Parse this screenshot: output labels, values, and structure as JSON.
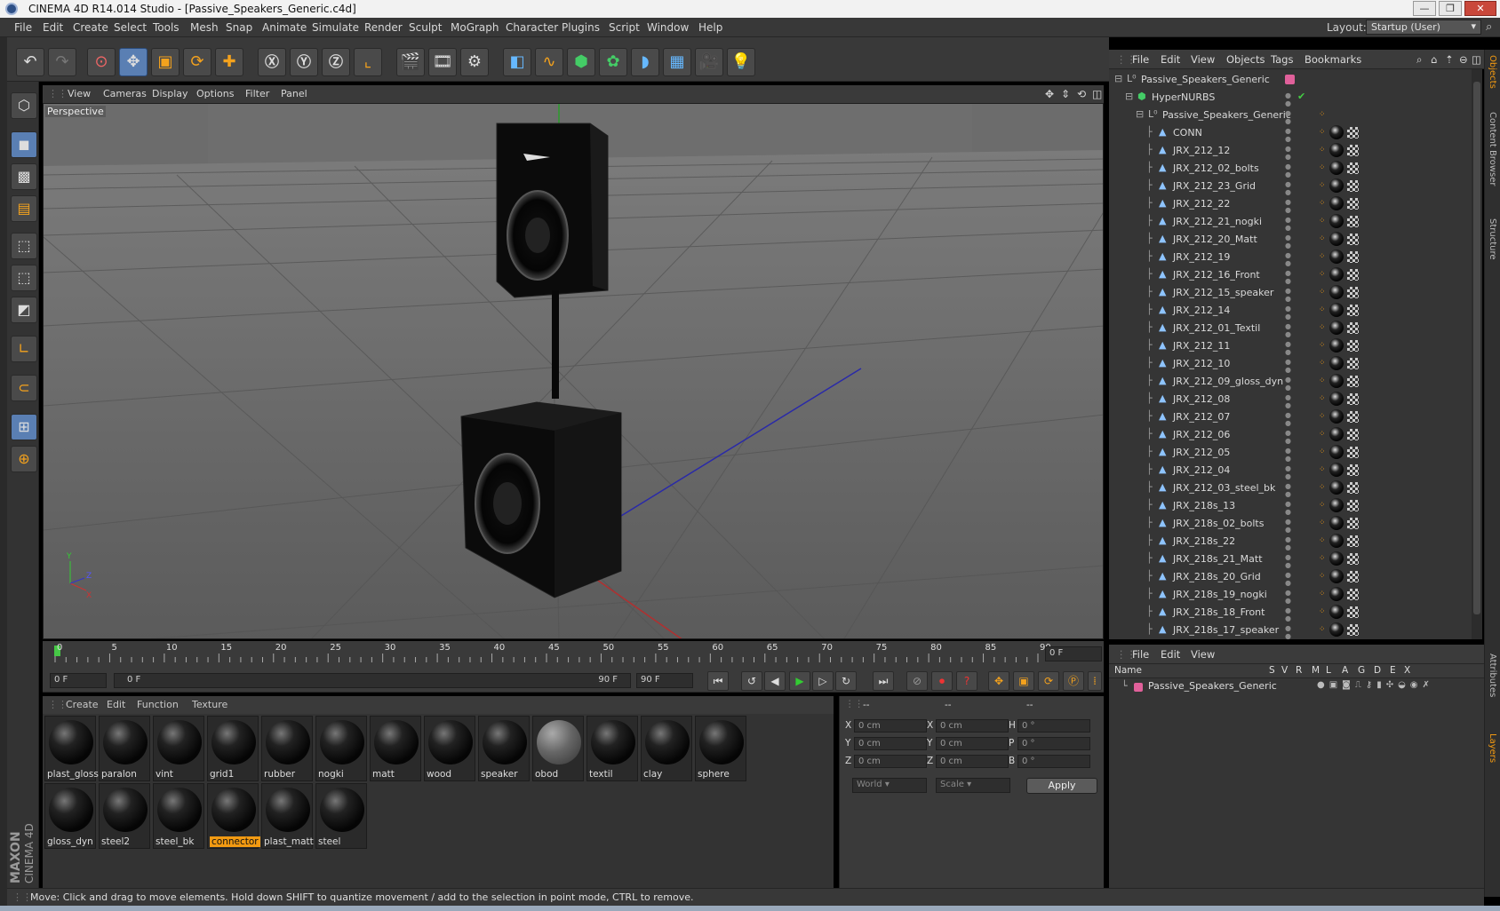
{
  "titlebar": {
    "title": "CINEMA 4D R14.014 Studio - [Passive_Speakers_Generic.c4d]",
    "min": "—",
    "max": "❐",
    "close": "✕"
  },
  "menubar": {
    "items": [
      "File",
      "Edit",
      "Create",
      "Select",
      "Tools",
      "Mesh",
      "Snap",
      "Animate",
      "Simulate",
      "Render",
      "Sculpt",
      "MoGraph",
      "Character",
      "Plugins",
      "Script",
      "Window",
      "Help"
    ],
    "layout_label": "Layout:",
    "layout_value": "Startup (User)"
  },
  "viewport": {
    "menu": [
      "View",
      "Cameras",
      "Display",
      "Options",
      "Filter",
      "Panel"
    ],
    "label": "Perspective"
  },
  "timeline": {
    "ticks": [
      "0",
      "5",
      "10",
      "15",
      "20",
      "25",
      "30",
      "35",
      "40",
      "45",
      "50",
      "55",
      "60",
      "65",
      "70",
      "75",
      "80",
      "85",
      "90"
    ],
    "current_frame": "0 F",
    "start_field": "0 F",
    "range_start": "0 F",
    "range_end": "90 F",
    "end_field": "90 F"
  },
  "materials": {
    "menu": [
      "Create",
      "Edit",
      "Function",
      "Texture"
    ],
    "row1": [
      "plast_gloss",
      "paralon",
      "vint",
      "grid1",
      "rubber",
      "nogki",
      "matt",
      "wood",
      "speaker",
      "obod",
      "textil",
      "clay",
      "sphere"
    ],
    "row2": [
      "gloss_dyn",
      "steel2",
      "steel_bk",
      "connector",
      "plast_matt",
      "steel"
    ],
    "selected": "connector"
  },
  "coordinates": {
    "headers": [
      "--",
      "--",
      "--"
    ],
    "rows": [
      {
        "a": "X",
        "av": "0 cm",
        "b": "X",
        "bv": "0 cm",
        "c": "H",
        "cv": "0 °"
      },
      {
        "a": "Y",
        "av": "0 cm",
        "b": "Y",
        "bv": "0 cm",
        "c": "P",
        "cv": "0 °"
      },
      {
        "a": "Z",
        "av": "0 cm",
        "b": "Z",
        "bv": "0 cm",
        "c": "B",
        "cv": "0 °"
      }
    ],
    "world": "World",
    "scale": "Scale",
    "apply": "Apply"
  },
  "objects": {
    "menu": [
      "File",
      "Edit",
      "View",
      "Objects",
      "Tags",
      "Bookmarks"
    ],
    "root": "Passive_Speakers_Generic",
    "hypernurbs": "HyperNURBS",
    "group": "Passive_Speakers_Generic",
    "items": [
      "CONN",
      "JRX_212_12",
      "JRX_212_02_bolts",
      "JRX_212_23_Grid",
      "JRX_212_22",
      "JRX_212_21_nogki",
      "JRX_212_20_Matt",
      "JRX_212_19",
      "JRX_212_16_Front",
      "JRX_212_15_speaker",
      "JRX_212_14",
      "JRX_212_01_Textil",
      "JRX_212_11",
      "JRX_212_10",
      "JRX_212_09_gloss_dyn",
      "JRX_212_08",
      "JRX_212_07",
      "JRX_212_06",
      "JRX_212_05",
      "JRX_212_04",
      "JRX_212_03_steel_bk",
      "JRX_218s_13",
      "JRX_218s_02_bolts",
      "JRX_218s_22",
      "JRX_218s_21_Matt",
      "JRX_218s_20_Grid",
      "JRX_218s_19_nogki",
      "JRX_218s_18_Front",
      "JRX_218s_17_speaker"
    ]
  },
  "layers": {
    "menu": [
      "File",
      "Edit",
      "View"
    ],
    "columns": [
      "Name",
      "S",
      "V",
      "R",
      "M",
      "L",
      "A",
      "G",
      "D",
      "E",
      "X"
    ],
    "row": "Passive_Speakers_Generic"
  },
  "right_tabs": [
    "Objects",
    "Content Browser",
    "Structure",
    "Attributes",
    "Layers"
  ],
  "status": "Move: Click and drag to move elements. Hold down SHIFT to quantize movement / add to the selection in point mode, CTRL to remove.",
  "branding": {
    "maxon": "MAXON",
    "cinema": "CINEMA 4D"
  },
  "colors": {
    "accent": "#f29a12",
    "selection": "#5a7fb3",
    "layer": "#e0609a"
  }
}
